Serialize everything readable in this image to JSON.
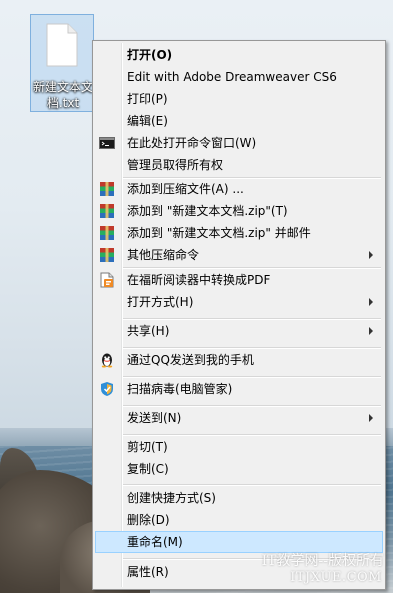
{
  "desktop": {
    "file_icon": "text-file-icon",
    "file_label": "新建文本文\n档.txt"
  },
  "context_menu": {
    "items": [
      {
        "label": "打开(O)",
        "bold": true
      },
      {
        "label": "Edit with Adobe Dreamweaver CS6"
      },
      {
        "label": "打印(P)"
      },
      {
        "label": "编辑(E)"
      },
      {
        "label": "在此处打开命令窗口(W)",
        "icon": "command-prompt-icon"
      },
      {
        "label": "管理员取得所有权"
      },
      {
        "label": "添加到压缩文件(A) ...",
        "icon": "winrar-icon"
      },
      {
        "label": "添加到 \"新建文本文档.zip\"(T)",
        "icon": "winrar-icon"
      },
      {
        "label": "添加到 \"新建文本文档.zip\" 并邮件",
        "icon": "winrar-icon"
      },
      {
        "label": "其他压缩命令",
        "icon": "winrar-icon",
        "submenu": true
      },
      {
        "label": "在福昕阅读器中转换成PDF",
        "icon": "foxit-pdf-icon"
      },
      {
        "label": "打开方式(H)",
        "submenu": true
      },
      {
        "label": "共享(H)",
        "submenu": true
      },
      {
        "label": "通过QQ发送到我的手机",
        "icon": "qq-penguin-icon"
      },
      {
        "label": "扫描病毒(电脑管家)",
        "icon": "pc-manager-shield-icon"
      },
      {
        "label": "发送到(N)",
        "submenu": true
      },
      {
        "label": "剪切(T)"
      },
      {
        "label": "复制(C)"
      },
      {
        "label": "创建快捷方式(S)"
      },
      {
        "label": "删除(D)"
      },
      {
        "label": "重命名(M)",
        "highlighted": true
      },
      {
        "label": "属性(R)"
      }
    ]
  },
  "watermark": {
    "line1": "IT教学网--版权所有",
    "line2": "ITJXUE.COM"
  },
  "colors": {
    "menu_bg": "#f0f0f0",
    "highlight_bg": "#cde8ff",
    "highlight_border": "#99d1ff",
    "selection_bg": "#a7cdf0"
  }
}
